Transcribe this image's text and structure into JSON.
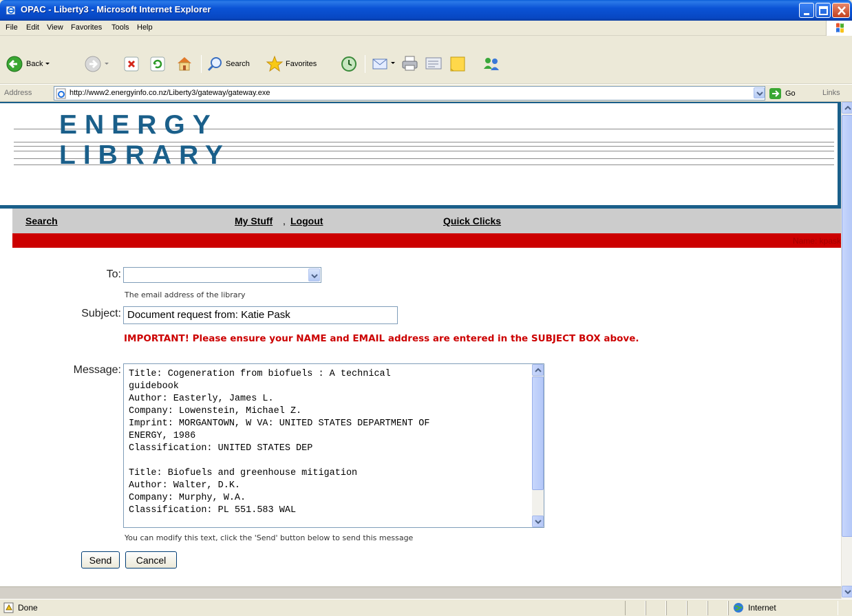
{
  "window": {
    "title": "OPAC - Liberty3 - Microsoft Internet Explorer"
  },
  "menu": {
    "items": [
      "File",
      "Edit",
      "View",
      "Favorites",
      "Tools",
      "Help"
    ]
  },
  "toolbar": {
    "back_label": "Back",
    "search_label": "Search",
    "favorites_label": "Favorites"
  },
  "address": {
    "label": "Address",
    "url": "http://www2.energyinfo.co.nz/Liberty3/gateway/gateway.exe",
    "go_label": "Go",
    "links_label": "Links"
  },
  "banner": {
    "line1": "ENERGY",
    "line2": "LIBRARY",
    "color": "#1a5f8a"
  },
  "nav": {
    "search": "Search",
    "my_stuff": "My Stuff",
    "separator": ",",
    "logout": "Logout",
    "quick_clicks": "Quick Clicks"
  },
  "user": {
    "name_text": "Name: kpask"
  },
  "form": {
    "to_label": "To:",
    "to_value": "",
    "to_hint": "The email address of the library",
    "subject_label": "Subject:",
    "subject_value": "Document request from: Katie Pask",
    "important": "IMPORTANT! Please ensure your NAME and EMAIL address are entered in the SUBJECT BOX above.",
    "message_label": "Message:",
    "message_lines": [
      "Title: Cogeneration from biofuels : A technical",
      "guidebook",
      "Author: Easterly, James L.",
      "Company: Lowenstein, Michael Z.",
      "Imprint: MORGANTOWN, W VA: UNITED STATES DEPARTMENT OF",
      "ENERGY, 1986",
      "Classification: UNITED STATES DEP",
      "",
      "Title: Biofuels and greenhouse mitigation",
      "Author: Walter, D.K.",
      "Company: Murphy, W.A.",
      "Classification: PL 551.583 WAL"
    ],
    "message_hint": "You can modify this text, click the 'Send' button below to send this message",
    "send_label": "Send",
    "cancel_label": "Cancel"
  },
  "status": {
    "text": "Done",
    "zone": "Internet"
  },
  "colors": {
    "nav_bg": "#cccccc",
    "red_bar": "#cc0000",
    "important_text": "#cc0000"
  }
}
